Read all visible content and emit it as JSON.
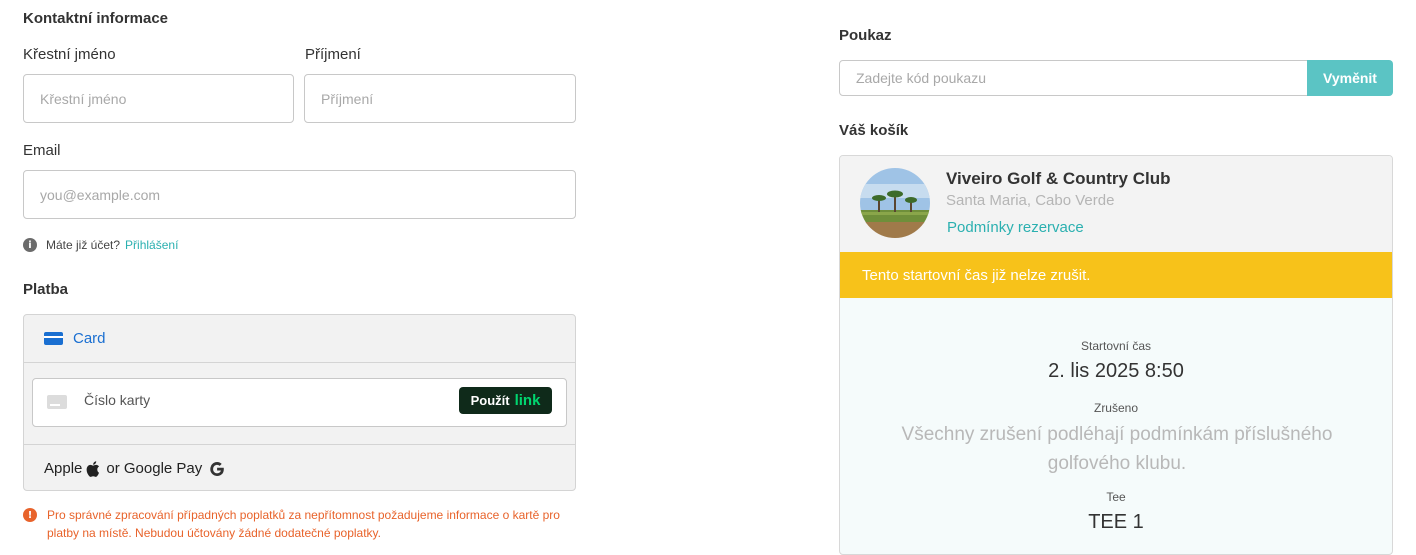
{
  "contact": {
    "title": "Kontaktní informace",
    "first_name_label": "Křestní jméno",
    "first_name_placeholder": "Křestní jméno",
    "last_name_label": "Příjmení",
    "last_name_placeholder": "Příjmení",
    "email_label": "Email",
    "email_placeholder": "you@example.com",
    "account_question": "Máte již účet?",
    "login_link": "Přihlášení"
  },
  "payment": {
    "title": "Platba",
    "tab_card": "Card",
    "card_number_placeholder": "Číslo karty",
    "link_button_prefix": "Použít",
    "link_button_brand": "link",
    "wallet_apple": "Apple",
    "wallet_or": "or Google Pay",
    "notice": "Pro správné zpracování případných poplatků za nepřítomnost požadujeme informace o kartě pro platby na místě. Nebudou účtovány žádné dodatečné poplatky."
  },
  "voucher": {
    "title": "Poukaz",
    "placeholder": "Zadejte kód poukazu",
    "button": "Vyměnit"
  },
  "cart": {
    "title": "Váš košík",
    "club_name": "Viveiro Golf & Country Club",
    "club_location": "Santa Maria, Cabo Verde",
    "terms_link": "Podmínky rezervace",
    "banner": "Tento startovní čas již nelze zrušit.",
    "tee_time_label": "Startovní čas",
    "tee_time_value": "2. lis 2025 8:50",
    "cancel_label": "Zrušeno",
    "cancel_text": "Všechny zrušení podléhají podmínkám příslušného golfového klubu.",
    "tee_label": "Tee",
    "tee_value": "TEE 1"
  },
  "colors": {
    "accent": "#2bb0b0",
    "button_teal": "#5bc4c4",
    "card_blue": "#1a6fd1",
    "warning_orange": "#e8632b",
    "banner_yellow": "#f7c21a"
  }
}
